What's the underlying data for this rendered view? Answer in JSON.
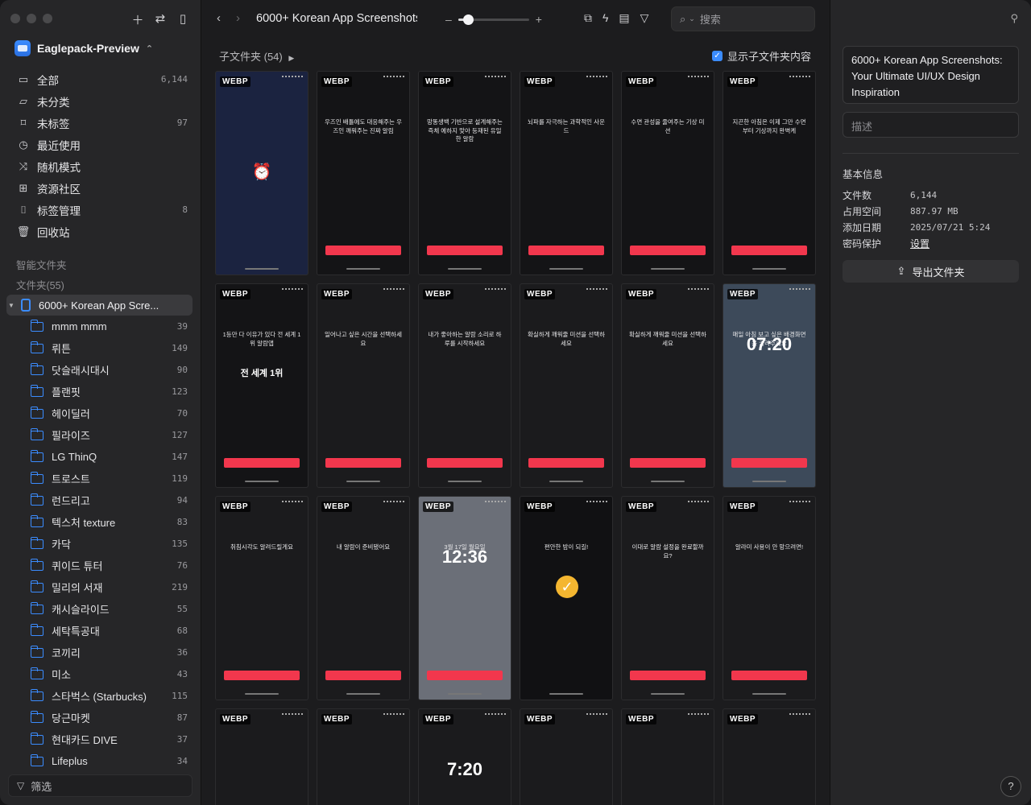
{
  "sidebar": {
    "library_name": "Eaglepack-Preview",
    "nav": [
      {
        "icon": "inbox-icon",
        "glyph": "▭",
        "label": "全部",
        "count": "6,144"
      },
      {
        "icon": "folder-question-icon",
        "glyph": "▱",
        "label": "未分类",
        "count": ""
      },
      {
        "icon": "tag-off-icon",
        "glyph": "⌑",
        "label": "未标签",
        "count": "97"
      },
      {
        "icon": "clock-icon",
        "glyph": "◷",
        "label": "最近使用",
        "count": ""
      },
      {
        "icon": "shuffle-icon",
        "glyph": "⤨",
        "label": "随机模式",
        "count": ""
      },
      {
        "icon": "community-icon",
        "glyph": "⊞",
        "label": "资源社区",
        "count": ""
      },
      {
        "icon": "bookmark-icon",
        "glyph": "⌷",
        "label": "标签管理",
        "count": "8"
      },
      {
        "icon": "trash-icon",
        "glyph": "🗑",
        "label": "回收站",
        "count": ""
      }
    ],
    "smart_folders_label": "智能文件夹",
    "folders_label": "文件夹(55)",
    "root_folder": "6000+ Korean App Scre...",
    "subfolders": [
      {
        "label": "mmm mmm",
        "count": "39"
      },
      {
        "label": "뤼튼",
        "count": "149"
      },
      {
        "label": "닷슬래시대시",
        "count": "90"
      },
      {
        "label": "플랜핏",
        "count": "123"
      },
      {
        "label": "헤이딜러",
        "count": "70"
      },
      {
        "label": "필라이즈",
        "count": "127"
      },
      {
        "label": "LG ThinQ",
        "count": "147"
      },
      {
        "label": "트로스트",
        "count": "119"
      },
      {
        "label": "런드리고",
        "count": "94"
      },
      {
        "label": "텍스처 texture",
        "count": "83"
      },
      {
        "label": "카닥",
        "count": "135"
      },
      {
        "label": "퀴이드 튜터",
        "count": "76"
      },
      {
        "label": "밀리의 서재",
        "count": "219"
      },
      {
        "label": "캐시슬라이드",
        "count": "55"
      },
      {
        "label": "세탁특공대",
        "count": "68"
      },
      {
        "label": "코끼리",
        "count": "36"
      },
      {
        "label": "미소",
        "count": "43"
      },
      {
        "label": "스타벅스 (Starbucks)",
        "count": "115"
      },
      {
        "label": "당근마켓",
        "count": "87"
      },
      {
        "label": "현대카드 DIVE",
        "count": "37"
      },
      {
        "label": "Lifeplus",
        "count": "34"
      }
    ],
    "filter_label": "筛选"
  },
  "toolbar": {
    "title": "6000+ Korean App Screenshots: Your Ultimate UI/UX Design Inspiration",
    "zoom_fraction": 0.1,
    "search_placeholder": "搜索"
  },
  "content": {
    "subfolder_header": "子文件夹 (54)",
    "show_subfolder_label": "显示子文件夹内容",
    "badge": "WEBP",
    "thumbs": [
      {
        "bg": "#1b2340",
        "text": "",
        "big": ""
      },
      {
        "bg": "#141416",
        "text": "우즈인 배틀에도 대응해주는 우즈인 깨워주는 진짜 알림",
        "big": ""
      },
      {
        "bg": "#141416",
        "text": "망똥생백 기반으로 설계해주는 즉체 예하지 맞아 등재된 유일한 알람",
        "big": ""
      },
      {
        "bg": "#141416",
        "text": "뇌파를 자극하는 과학적인 사운드",
        "big": ""
      },
      {
        "bg": "#141416",
        "text": "수면 관성을 줄여주는 기상 미션",
        "big": ""
      },
      {
        "bg": "#141416",
        "text": "지끈한 아침은 이제 그만 수면부터 기상까지 완벽케",
        "big": ""
      },
      {
        "bg": "#141416",
        "text": "1등만 다 이유가 있다 전 세계 1위 알람앱",
        "big": "전 세계 1위"
      },
      {
        "bg": "#1b1b1d",
        "text": "일어나고 싶은 시간을 선택하세요",
        "big": ""
      },
      {
        "bg": "#1b1b1d",
        "text": "내가 좋아하는 알람 소리로 하루를 시작하세요",
        "big": ""
      },
      {
        "bg": "#1b1b1d",
        "text": "확실하게 깨워줄 미션을 선택하세요",
        "big": ""
      },
      {
        "bg": "#1b1b1d",
        "text": "확실하게 깨워줄 미션을 선택하세요",
        "big": ""
      },
      {
        "bg": "#3d4a5a",
        "text": "매일 아침 보고 싶은 배경화면을 골라주세요",
        "big": "07:20"
      },
      {
        "bg": "#1b1b1d",
        "text": "취침시각도 알려드릴게요",
        "big": ""
      },
      {
        "bg": "#1b1b1d",
        "text": "내 알람이 준비됐어요",
        "big": ""
      },
      {
        "bg": "#6b6f78",
        "text": "3월 17일 월요일",
        "big": "12:36"
      },
      {
        "bg": "#111113",
        "text": "편안한 밤이 되길!",
        "big": ""
      },
      {
        "bg": "#1b1b1d",
        "text": "이대로 알람 설정을 완료할까요?",
        "big": ""
      },
      {
        "bg": "#1b1b1d",
        "text": "알라미 사용이 안 망으려면!",
        "big": ""
      },
      {
        "bg": "#1b1b1d",
        "text": "",
        "big": ""
      },
      {
        "bg": "#1b1b1d",
        "text": "",
        "big": ""
      },
      {
        "bg": "#1b1b1d",
        "text": "",
        "big": "7:20"
      },
      {
        "bg": "#1b1b1d",
        "text": "",
        "big": ""
      },
      {
        "bg": "#1b1b1d",
        "text": "",
        "big": ""
      },
      {
        "bg": "#1b1b1d",
        "text": "",
        "big": ""
      }
    ]
  },
  "inspector": {
    "name": "6000+ Korean App Screenshots: Your Ultimate UI/UX Design Inspiration",
    "description_placeholder": "描述",
    "basic_info_label": "基本信息",
    "rows": [
      {
        "key": "文件数",
        "value": "6,144",
        "link": false
      },
      {
        "key": "占用空间",
        "value": "887.97 MB",
        "link": false
      },
      {
        "key": "添加日期",
        "value": "2025/07/21 5:24",
        "link": false
      },
      {
        "key": "密码保护",
        "value": "设置",
        "link": true
      }
    ],
    "export_label": "导出文件夹",
    "help_label": "?"
  },
  "colors": {
    "accent": "#3b8cff",
    "cta": "#f2374d"
  }
}
